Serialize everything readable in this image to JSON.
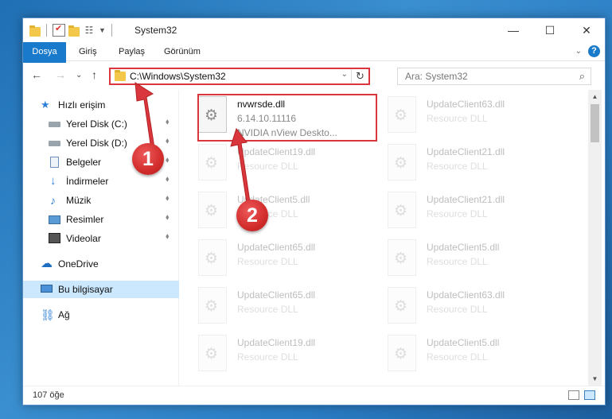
{
  "window": {
    "title": "System32",
    "minimize": "—",
    "maximize": "☐",
    "close": "✕"
  },
  "ribbon": {
    "tabs": [
      "Dosya",
      "Giriş",
      "Paylaş",
      "Görünüm"
    ],
    "expand": "⌄",
    "help": "?"
  },
  "nav": {
    "back": "←",
    "forward": "→",
    "recent": "⌄",
    "up": "↑",
    "address": "C:\\Windows\\System32",
    "dropdown": "⌄",
    "refresh": "↻",
    "search_placeholder": "Ara: System32",
    "search_icon": "⌕"
  },
  "sidebar": {
    "items": [
      {
        "label": "Hızlı erişim",
        "icon": "star-icon"
      },
      {
        "label": "Yerel Disk (C:)",
        "icon": "disk-icon",
        "pinned": true
      },
      {
        "label": "Yerel Disk (D:)",
        "icon": "disk-icon",
        "pinned": true
      },
      {
        "label": "Belgeler",
        "icon": "document-icon",
        "pinned": true
      },
      {
        "label": "İndirmeler",
        "icon": "download-icon",
        "pinned": true
      },
      {
        "label": "Müzik",
        "icon": "music-icon",
        "pinned": true
      },
      {
        "label": "Resimler",
        "icon": "pictures-icon",
        "pinned": true
      },
      {
        "label": "Videolar",
        "icon": "video-icon",
        "pinned": true
      },
      {
        "label": "OneDrive",
        "icon": "cloud-icon"
      },
      {
        "label": "Bu bilgisayar",
        "icon": "computer-icon",
        "selected": true
      },
      {
        "label": "Ağ",
        "icon": "network-icon"
      }
    ],
    "pin_glyph": "📌"
  },
  "files": {
    "highlighted": {
      "name": "nvwrsde.dll",
      "version": "6.14.10.11116",
      "description": "NVIDIA nView Deskto..."
    },
    "col1": [
      {
        "name": "UpdateClient19.dll",
        "type": "Resource DLL"
      },
      {
        "name": "UpdateClient5.dll",
        "type": "Resource DLL"
      },
      {
        "name": "UpdateClient65.dll",
        "type": "Resource DLL"
      },
      {
        "name": "UpdateClient65.dll",
        "type": "Resource DLL"
      },
      {
        "name": "UpdateClient19.dll",
        "type": "Resource DLL"
      }
    ],
    "col2": [
      {
        "name": "UpdateClient63.dll",
        "type": "Resource DLL"
      },
      {
        "name": "UpdateClient21.dll",
        "type": "Resource DLL"
      },
      {
        "name": "UpdateClient21.dll",
        "type": "Resource DLL"
      },
      {
        "name": "UpdateClient5.dll",
        "type": "Resource DLL"
      },
      {
        "name": "UpdateClient63.dll",
        "type": "Resource DLL"
      },
      {
        "name": "UpdateClient5.dll",
        "type": "Resource DLL"
      }
    ]
  },
  "status": {
    "item_count": "107 öğe"
  },
  "annotations": {
    "step1": "1",
    "step2": "2",
    "color": "#d9363e"
  }
}
